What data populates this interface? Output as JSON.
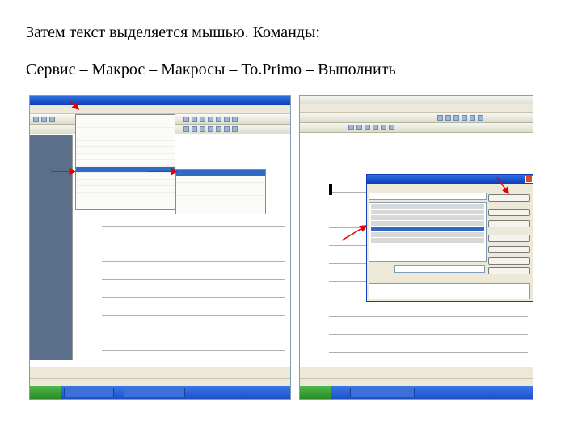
{
  "text": {
    "line1": "Затем текст выделяется мышью. Команды:",
    "line2": "Сервис – Макрос – Макросы – To.Primo – Выполнить"
  },
  "colors": {
    "window_title_blue": "#0a3fb8",
    "menu_highlight": "#316ac5",
    "arrow_red": "#e00000",
    "taskbar_blue": "#2a5fd8",
    "start_green": "#3aa53a"
  },
  "icons": [
    "red-arrow-icon",
    "close-icon"
  ]
}
